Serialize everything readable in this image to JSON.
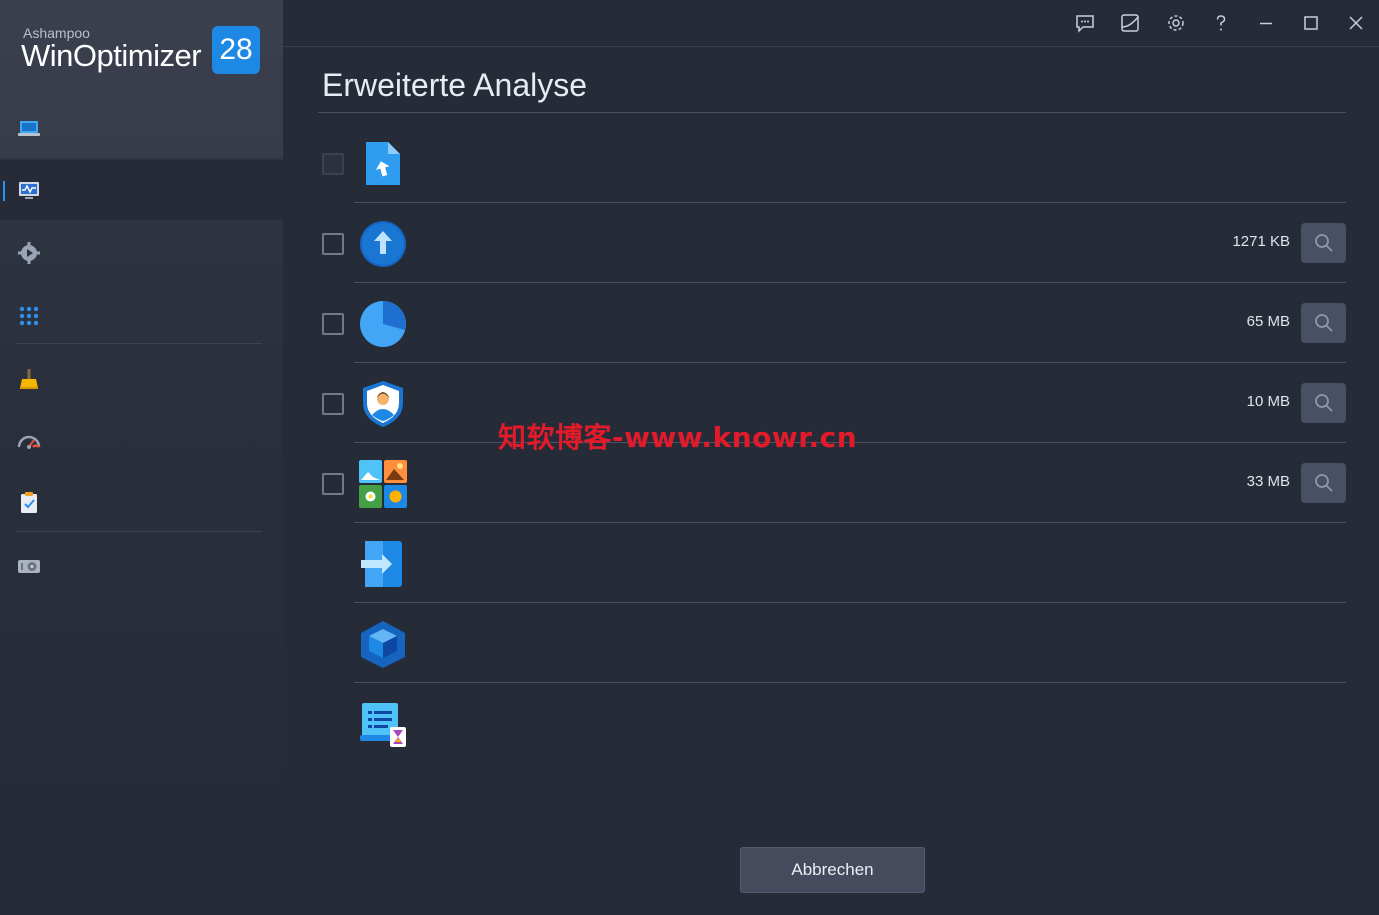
{
  "app": {
    "vendor": "Ashampoo",
    "product": "WinOptimizer",
    "version_badge": "28"
  },
  "sidebar": {
    "items": [
      {
        "icon": "laptop-icon",
        "active": false
      },
      {
        "icon": "system-monitor-icon",
        "active": true
      },
      {
        "icon": "gear-play-icon",
        "active": false
      },
      {
        "icon": "apps-grid-icon",
        "active": false
      },
      {
        "icon": "broom-cleaner-icon",
        "active": false
      },
      {
        "icon": "speedometer-icon",
        "active": false
      },
      {
        "icon": "clipboard-check-icon",
        "active": false
      },
      {
        "icon": "disk-drive-icon",
        "active": false
      }
    ]
  },
  "titlebar": {
    "buttons": [
      "feedback-icon",
      "skin-icon",
      "settings-icon",
      "help-icon",
      "minimize-icon",
      "maximize-icon",
      "close-icon"
    ]
  },
  "main": {
    "title": "Erweiterte Analyse",
    "rows": [
      {
        "icon": "file-upload-icon",
        "has_checkbox": true,
        "checkbox_disabled": true,
        "size": ""
      },
      {
        "icon": "upload-circle-icon",
        "has_checkbox": true,
        "checkbox_disabled": false,
        "size": "1271 KB"
      },
      {
        "icon": "pie-chart-icon",
        "has_checkbox": true,
        "checkbox_disabled": false,
        "size": "65 MB"
      },
      {
        "icon": "user-shield-icon",
        "has_checkbox": true,
        "checkbox_disabled": false,
        "size": "10 MB"
      },
      {
        "icon": "image-gallery-icon",
        "has_checkbox": true,
        "checkbox_disabled": false,
        "size": "33 MB"
      },
      {
        "icon": "file-arrow-icon",
        "has_checkbox": false,
        "size": ""
      },
      {
        "icon": "cube-icon",
        "has_checkbox": false,
        "size": ""
      },
      {
        "icon": "document-hourglass-icon",
        "has_checkbox": false,
        "size": ""
      }
    ],
    "cancel_label": "Abbrechen"
  },
  "watermark": "知软博客-www.knowr.cn",
  "colors": {
    "accent": "#1e88e5",
    "background": "#262b38",
    "sidebar": "#2a2f3c",
    "button": "#454b5d",
    "watermark": "#e21b2a"
  }
}
